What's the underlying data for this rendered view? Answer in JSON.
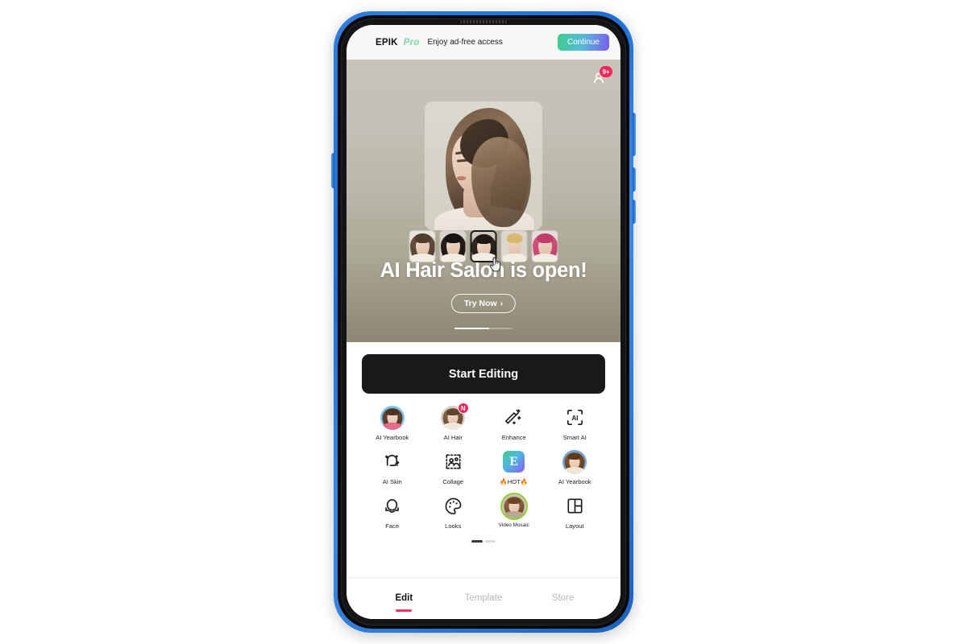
{
  "promo": {
    "brand": "EPIK",
    "brand_pro": "Pro",
    "tagline": "Enjoy ad-free access",
    "cta": "Continue",
    "cta_gradient_from": "#3ecf8e",
    "cta_gradient_to": "#7b5cf0"
  },
  "hero": {
    "notification_icon": "notification-bell-icon",
    "notification_badge": "9+",
    "badge_color": "#f3265b",
    "title": "AI Hair Salon is open!",
    "cta": "Try Now",
    "cta_chevron": "›",
    "bg_from": "#c6c4b8",
    "bg_to": "#8b8775",
    "carousel_position": 1,
    "carousel_total": 2,
    "thumbnails": [
      {
        "name": "straight-brown",
        "hair": "#6b5444",
        "hair2": "#4f3d30",
        "bg": "#e8e4dd",
        "selected": false
      },
      {
        "name": "long-black",
        "hair": "#2b2320",
        "hair2": "#191311",
        "bg": "#d9d5ce",
        "selected": false
      },
      {
        "name": "dark-ombre",
        "hair": "#3a2c24",
        "hair2": "#201814",
        "bg": "#cfcabf",
        "selected": true
      },
      {
        "name": "blonde",
        "hair": "#e0c municipal",
        "hair2": "#d9b972",
        "bg": "#ddd8cf",
        "selected": false
      },
      {
        "name": "pink",
        "hair": "#d9587f",
        "hair2": "#c03f6a",
        "bg": "#e6dcd9",
        "selected": false
      }
    ],
    "cursor_icon": "hand-pointer-icon"
  },
  "sheet": {
    "start_editing": "Start Editing",
    "grid_page": 1,
    "grid_total": 2,
    "tiles": [
      {
        "label": "AI Yearbook",
        "icon": "ai-yearbook-avatar-icon",
        "kind": "avatar",
        "badge": null,
        "hair": "#6d4a33",
        "hair2": "#4c3324",
        "bg": "#7fc3e8",
        "body": "#e86a8a",
        "ring": false,
        "tiny": false
      },
      {
        "label": "AI Hair",
        "icon": "ai-hair-avatar-icon",
        "kind": "avatar",
        "badge": "N",
        "hair": "#8e6c4e",
        "hair2": "#5e432e",
        "bg": "#d9cfc4",
        "body": "#f0e7dc",
        "ring": false,
        "tiny": false
      },
      {
        "label": "Enhance",
        "icon": "magic-wand-icon",
        "kind": "svg-enhance",
        "badge": null,
        "tiny": false
      },
      {
        "label": "Smart AI",
        "icon": "smart-ai-bracket-icon",
        "kind": "svg-smartai",
        "badge": null,
        "tiny": false
      },
      {
        "label": "AI Skin",
        "icon": "ai-skin-face-icon",
        "kind": "svg-aiskin",
        "badge": null,
        "tiny": false
      },
      {
        "label": "Collage",
        "icon": "collage-frame-icon",
        "kind": "svg-collage",
        "badge": null,
        "tiny": false
      },
      {
        "label": "🔥HOT🔥",
        "icon": "epik-e-logo-icon",
        "kind": "elogo",
        "badge": null,
        "tiny": false
      },
      {
        "label": "AI Yearbook",
        "icon": "ai-yearbook-avatar-icon-2",
        "kind": "avatar",
        "badge": null,
        "hair": "#8a5a30",
        "hair2": "#5d3a1d",
        "bg": "#6fa8d6",
        "body": "#f1e6d6",
        "ring": false,
        "tiny": false
      },
      {
        "label": "Face",
        "icon": "face-outline-icon",
        "kind": "svg-face",
        "badge": null,
        "tiny": false
      },
      {
        "label": "Looks",
        "icon": "paint-palette-icon",
        "kind": "svg-looks",
        "badge": null,
        "tiny": false
      },
      {
        "label": "Video Mosaic",
        "icon": "video-mosaic-avatar-icon",
        "kind": "avatar",
        "badge": null,
        "hair": "#9a6a42",
        "hair2": "#6d4627",
        "bg": "#c9c2bb",
        "body": "#b7a994",
        "ring": true,
        "tiny": true
      },
      {
        "label": "Layout",
        "icon": "layout-grid-icon",
        "kind": "svg-layout",
        "badge": null,
        "tiny": false
      }
    ]
  },
  "tabs": [
    {
      "label": "Edit",
      "active": true
    },
    {
      "label": "Template",
      "active": false
    },
    {
      "label": "Store",
      "active": false
    }
  ],
  "accent": {
    "active_tab": "#f2315c",
    "button_dark": "#19191b"
  }
}
